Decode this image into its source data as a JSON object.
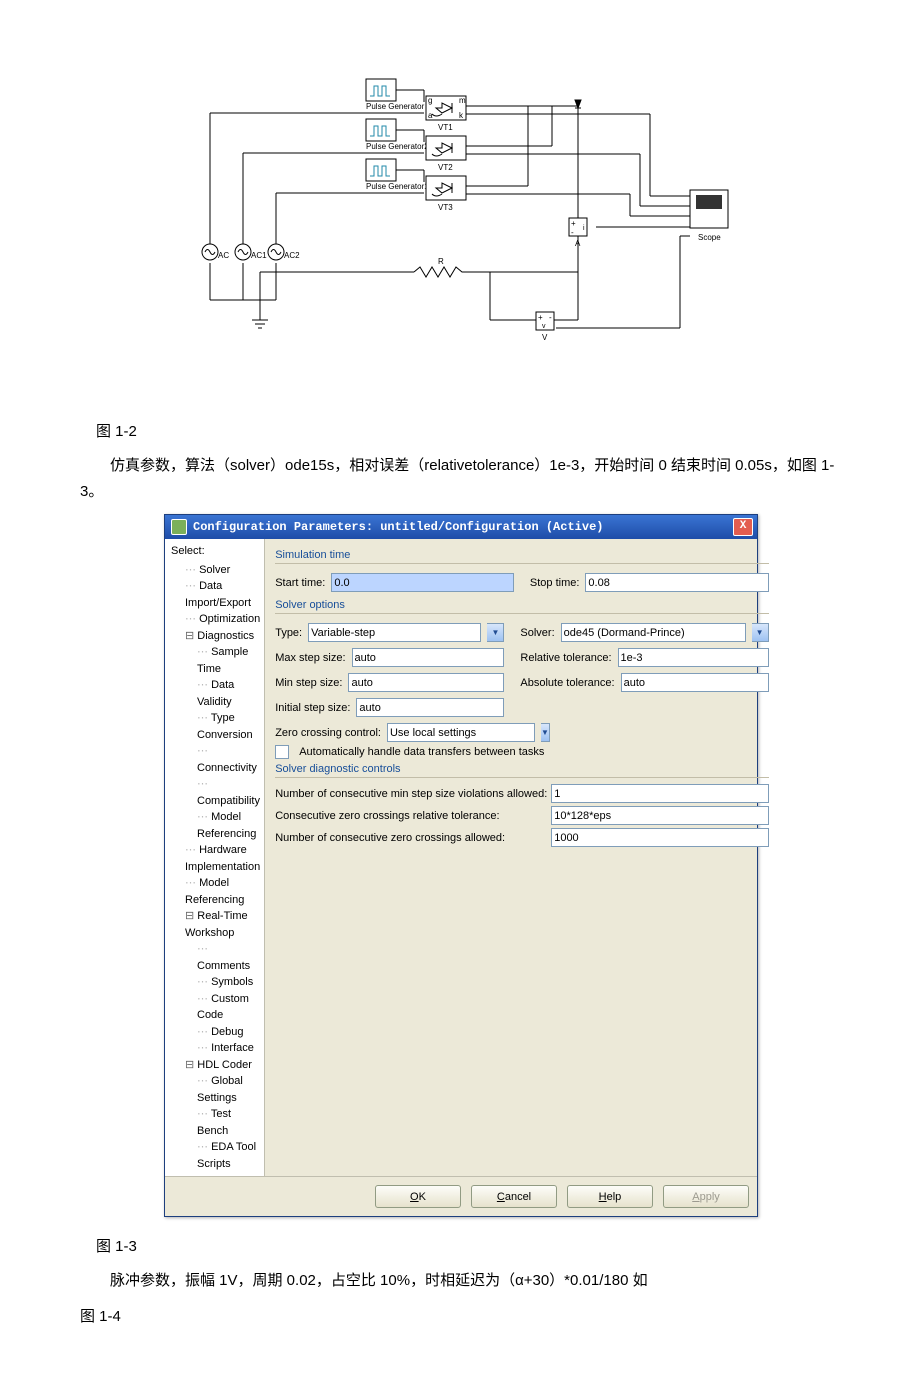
{
  "diagram": {
    "blocks": {
      "pulse": "Pulse Generator",
      "pulse2": "Pulse Generator2",
      "pulse1": "Pulse Generator1",
      "vt1": "VT1",
      "vt2": "VT2",
      "vt3": "VT3",
      "ac": "AC",
      "ac1": "AC1",
      "ac2": "AC2",
      "r": "R",
      "a": "A",
      "v": "V",
      "scope": "Scope",
      "thy_port_g": "g",
      "thy_port_a": "a",
      "thy_port_m": "m",
      "thy_port_k": "k",
      "port_plus": "+",
      "port_minus": "-",
      "port_v": "v",
      "port_i": "i"
    }
  },
  "captions": {
    "c1": "图 1-2",
    "c2": "图 1-3"
  },
  "paragraphs": {
    "p1": "仿真参数，算法（solver）ode15s，相对误差（relativetolerance）1e-3，开始时间 0 结束时间 0.05s，如图 1-3。",
    "p2a": "脉冲参数，振幅 1V，周期 0.02，占空比 10%，时相延迟为（α+30）*0.01/180 如",
    "p2b": "图 1-4"
  },
  "dialog": {
    "title": "Configuration Parameters: untitled/Configuration (Active)",
    "close": "X",
    "treeHeader": "Select:",
    "tree": [
      {
        "lvl": 1,
        "label": "Solver"
      },
      {
        "lvl": 1,
        "label": "Data Import/Export"
      },
      {
        "lvl": 1,
        "label": "Optimization"
      },
      {
        "lvl": 1,
        "label": "Diagnostics",
        "exp": true
      },
      {
        "lvl": 2,
        "label": "Sample Time"
      },
      {
        "lvl": 2,
        "label": "Data Validity"
      },
      {
        "lvl": 2,
        "label": "Type Conversion"
      },
      {
        "lvl": 2,
        "label": "Connectivity"
      },
      {
        "lvl": 2,
        "label": "Compatibility"
      },
      {
        "lvl": 2,
        "label": "Model Referencing"
      },
      {
        "lvl": 1,
        "label": "Hardware Implementation"
      },
      {
        "lvl": 1,
        "label": "Model Referencing"
      },
      {
        "lvl": 1,
        "label": "Real-Time Workshop",
        "exp": true
      },
      {
        "lvl": 2,
        "label": "Comments"
      },
      {
        "lvl": 2,
        "label": "Symbols"
      },
      {
        "lvl": 2,
        "label": "Custom Code"
      },
      {
        "lvl": 2,
        "label": "Debug"
      },
      {
        "lvl": 2,
        "label": "Interface"
      },
      {
        "lvl": 1,
        "label": "HDL Coder",
        "exp": true
      },
      {
        "lvl": 2,
        "label": "Global Settings"
      },
      {
        "lvl": 2,
        "label": "Test Bench"
      },
      {
        "lvl": 2,
        "label": "EDA Tool Scripts"
      }
    ],
    "sections": {
      "simTime": "Simulation time",
      "solverOpts": "Solver options",
      "diag": "Solver diagnostic controls"
    },
    "labels": {
      "startTime": "Start time:",
      "stopTime": "Stop time:",
      "type": "Type:",
      "solver": "Solver:",
      "maxStep": "Max step size:",
      "relTol": "Relative tolerance:",
      "minStep": "Min step size:",
      "absTol": "Absolute tolerance:",
      "initStep": "Initial step size:",
      "zcc": "Zero crossing control:",
      "autoHandle": "Automatically handle data transfers between tasks",
      "nMinStep": "Number of consecutive min step size violations allowed:",
      "consecZTol": "Consecutive zero crossings relative tolerance:",
      "nZc": "Number of consecutive zero crossings allowed:"
    },
    "values": {
      "startTime": "0.0",
      "stopTime": "0.08",
      "type": "Variable-step",
      "solver": "ode45 (Dormand-Prince)",
      "maxStep": "auto",
      "relTol": "1e-3",
      "minStep": "auto",
      "absTol": "auto",
      "initStep": "auto",
      "zcc": "Use local settings",
      "nMinStep": "1",
      "consecZTol": "10*128*eps",
      "nZc": "1000"
    },
    "buttons": {
      "ok": "OK",
      "cancel": "Cancel",
      "help": "Help",
      "apply": "Apply"
    }
  }
}
